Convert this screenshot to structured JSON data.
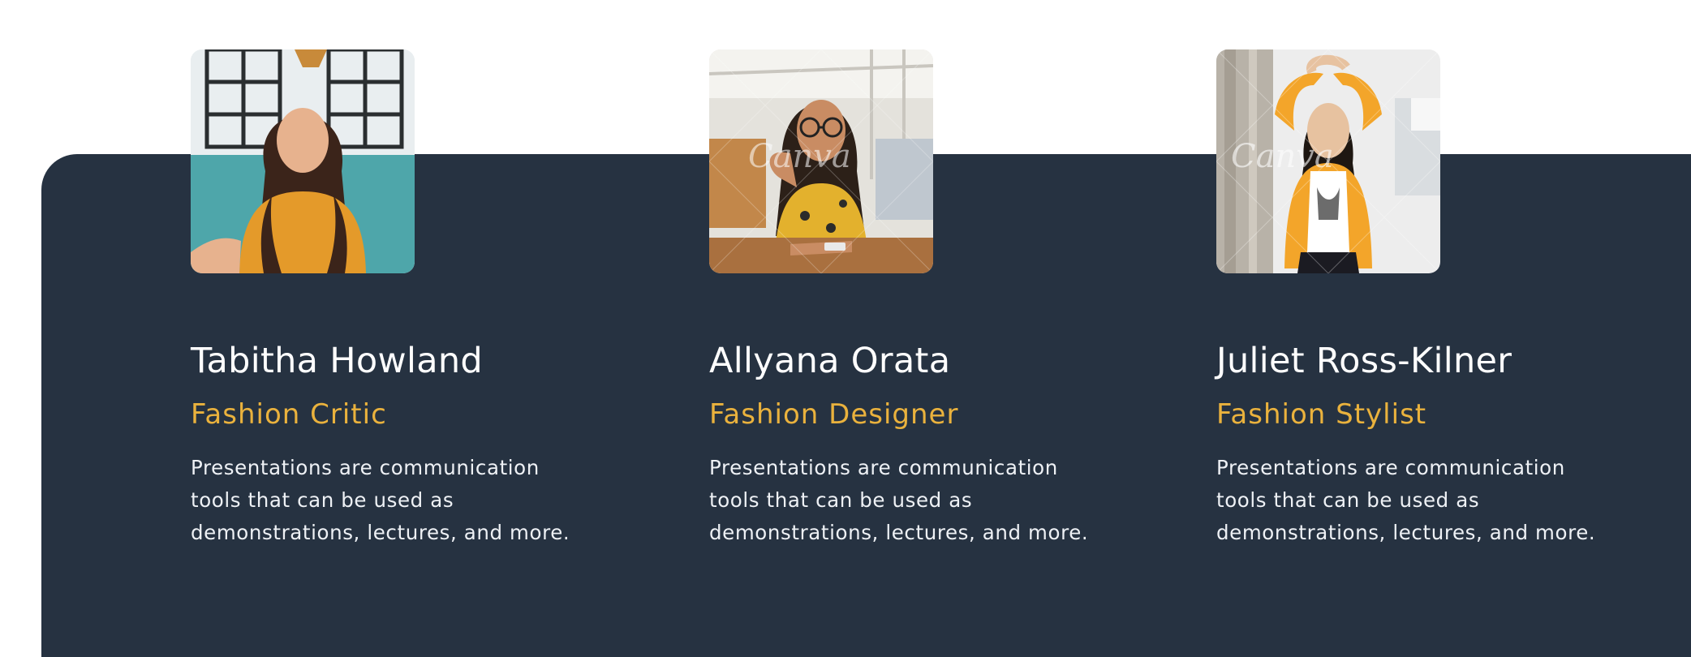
{
  "colors": {
    "background": "#ffffff",
    "panel": "#263241",
    "name_text": "#ffffff",
    "role_accent": "#eab23d",
    "body_text": "#eef1f5"
  },
  "team": [
    {
      "name": "Tabitha Howland",
      "role": "Fashion Critic",
      "description_lines": [
        "Presentations are communication",
        "tools that can be used as",
        "demonstrations, lectures, and more."
      ],
      "photo": "portrait-woman-orange-top-icon"
    },
    {
      "name": "Allyana Orata",
      "role": "Fashion Designer",
      "description_lines": [
        "Presentations are communication",
        "tools that can be used as",
        "demonstrations, lectures, and more."
      ],
      "photo": "portrait-woman-glasses-cafe-icon",
      "watermark": "Canva"
    },
    {
      "name": "Juliet Ross-Kilner",
      "role": "Fashion Stylist",
      "description_lines": [
        "Presentations are communication",
        "tools that can be used as",
        "demonstrations, lectures, and more."
      ],
      "photo": "portrait-woman-yellow-jacket-icon",
      "watermark": "Canva"
    }
  ]
}
